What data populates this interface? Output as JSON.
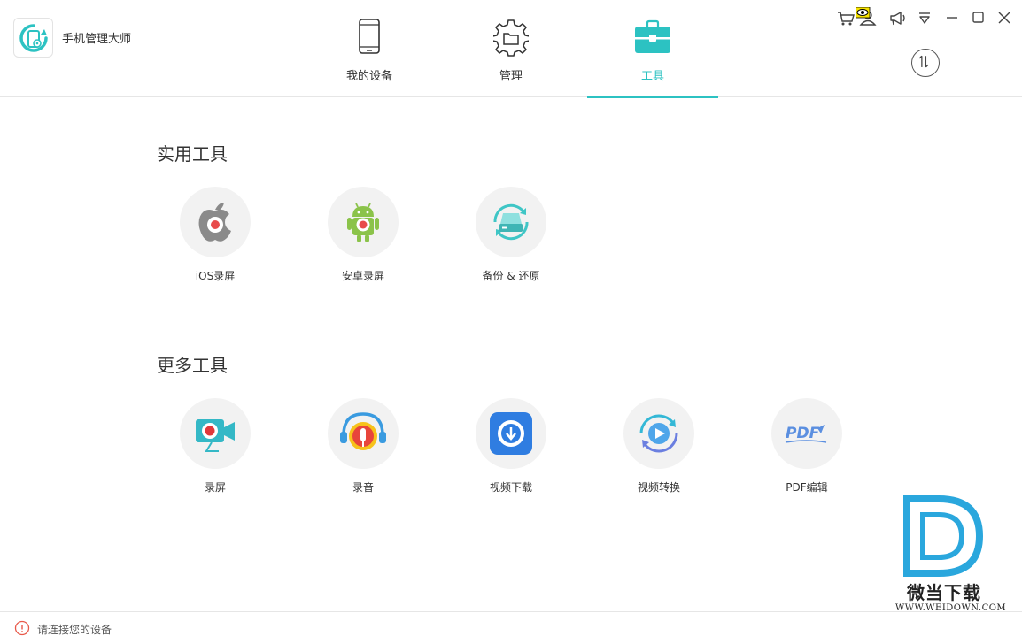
{
  "app": {
    "title": "手机管理大师",
    "accent_color": "#2cc2c2"
  },
  "nav": {
    "tabs": [
      {
        "label": "我的设备",
        "icon": "phone-icon",
        "active": false
      },
      {
        "label": "管理",
        "icon": "gear-folder-icon",
        "active": false
      },
      {
        "label": "工具",
        "icon": "toolbox-icon",
        "active": true
      }
    ]
  },
  "window_controls": [
    "cart-icon",
    "user-icon",
    "megaphone-icon",
    "menu-triangle-icon",
    "minimize-icon",
    "maximize-icon",
    "close-icon"
  ],
  "sections": {
    "practical": {
      "title": "实用工具",
      "tools": [
        {
          "label": "iOS录屏",
          "icon": "apple-record-icon"
        },
        {
          "label": "安卓录屏",
          "icon": "android-record-icon"
        },
        {
          "label": "备份 & 还原",
          "icon": "backup-restore-icon"
        }
      ]
    },
    "more": {
      "title": "更多工具",
      "tools": [
        {
          "label": "录屏",
          "icon": "screen-record-icon"
        },
        {
          "label": "录音",
          "icon": "audio-record-icon"
        },
        {
          "label": "视频下载",
          "icon": "video-download-icon"
        },
        {
          "label": "视频转换",
          "icon": "video-convert-icon"
        },
        {
          "label": "PDF编辑",
          "icon": "pdf-edit-icon"
        }
      ]
    }
  },
  "status": {
    "text": "请连接您的设备",
    "icon": "warning-icon"
  },
  "watermark": {
    "cn": "微当下载",
    "en": "WWW.WEIDOWN.COM"
  }
}
